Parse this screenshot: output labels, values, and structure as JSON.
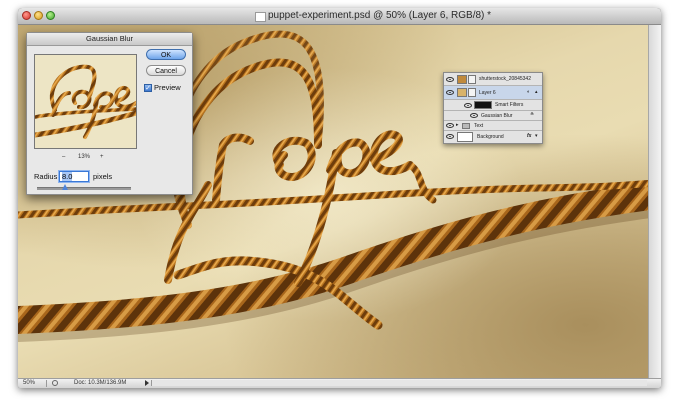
{
  "window": {
    "title": "puppet-experiment.psd @ 50% (Layer 6, RGB/8) *"
  },
  "status_bar": {
    "zoom": "50%",
    "doc_size": "Doc: 10.3M/136.9M"
  },
  "dialog": {
    "title": "Gaussian Blur",
    "ok_label": "OK",
    "cancel_label": "Cancel",
    "preview_label": "Preview",
    "preview_checked": true,
    "zoom_minus": "–",
    "zoom_percent": "13%",
    "zoom_plus": "+",
    "radius_label": "Radius:",
    "radius_value": "8.0",
    "radius_unit": "pixels",
    "radius_slider_fraction": 0.3
  },
  "layers_panel": {
    "layers": [
      {
        "name": "shutterstock_20845342",
        "visible": true,
        "selected": false
      },
      {
        "name": "Layer 6",
        "visible": true,
        "selected": true
      },
      {
        "name": "Smart Filters",
        "visible": true,
        "selected": false
      },
      {
        "name": "Gaussian Blur",
        "visible": true,
        "selected": false
      },
      {
        "name": "Text",
        "visible": true,
        "selected": false
      },
      {
        "name": "Background",
        "visible": true,
        "selected": false
      }
    ],
    "fx_label": "fx"
  },
  "colors": {
    "rope": "#b8741f",
    "rope_dark": "#6e3d0c",
    "rope_highlight": "#e8a94c",
    "paper": "#e6d8ad",
    "ok_blue": "#6ea4ea"
  }
}
